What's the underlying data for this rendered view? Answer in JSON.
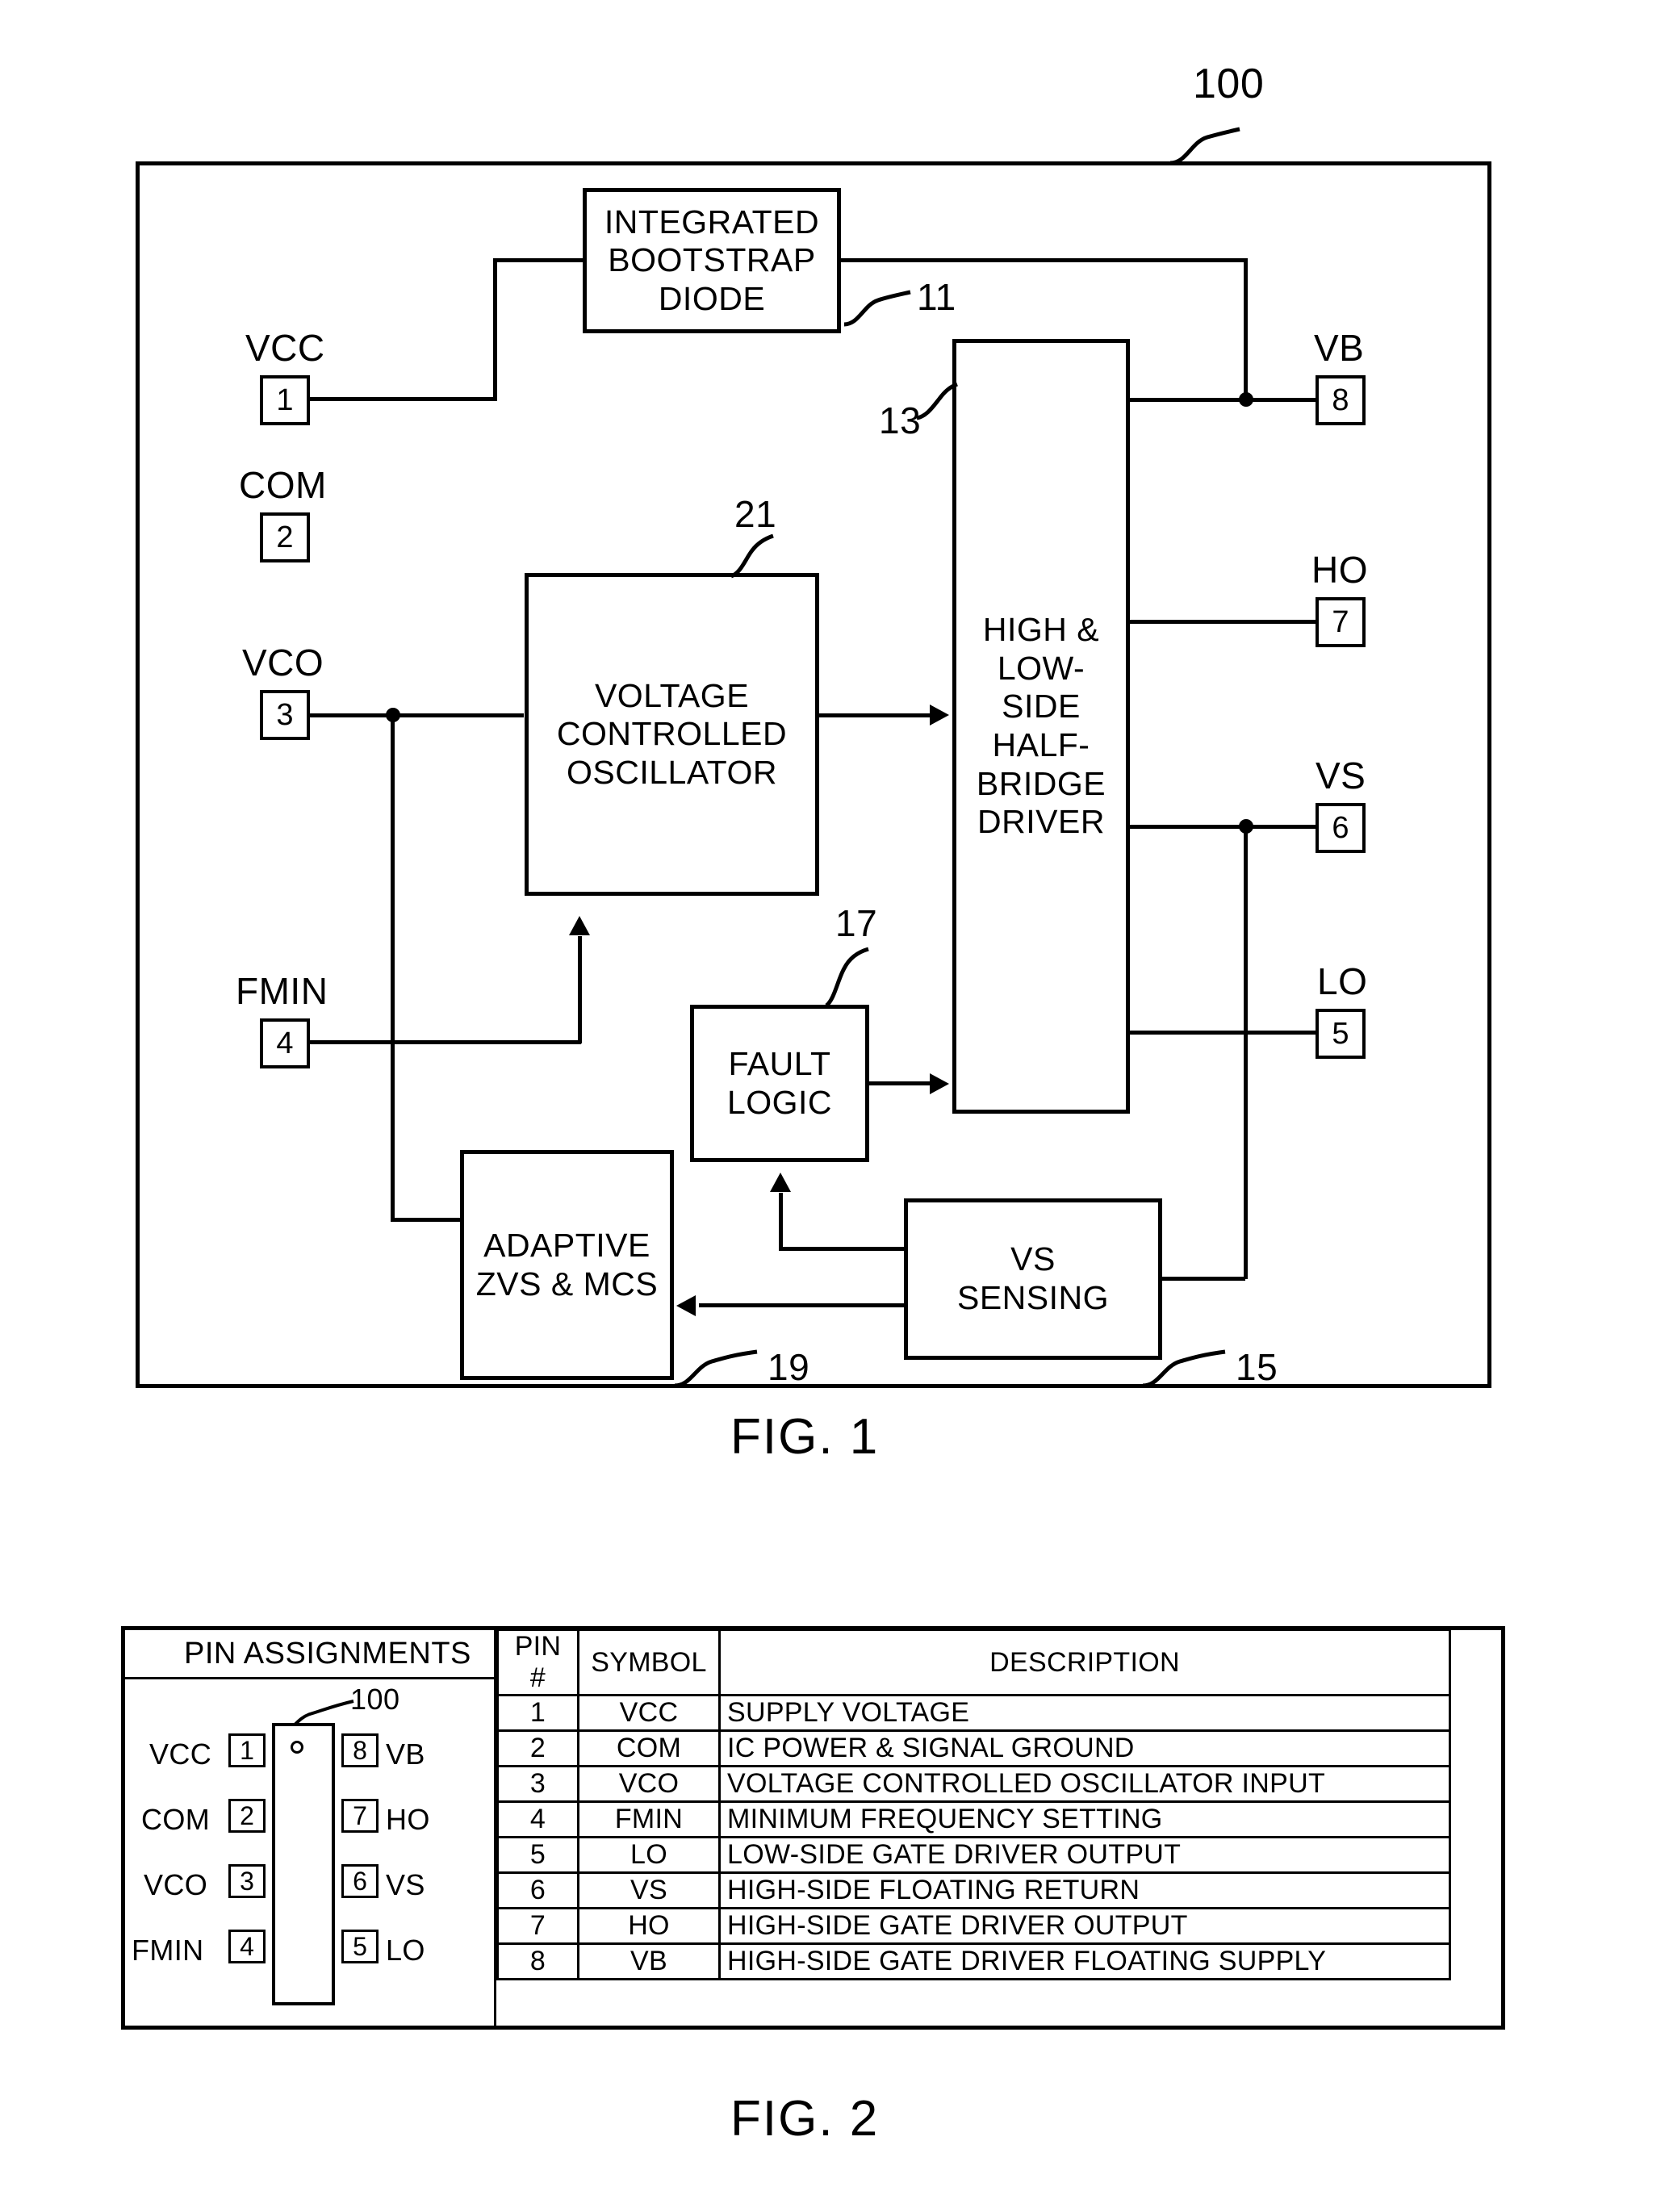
{
  "figure1": {
    "caption": "FIG. 1",
    "device_ref": "100",
    "blocks": [
      {
        "id": "bootstrap",
        "label": "INTEGRATED\nBOOTSTRAP\nDIODE",
        "ref": "11"
      },
      {
        "id": "vco",
        "label": "VOLTAGE\nCONTROLLED\nOSCILLATOR",
        "ref": "21"
      },
      {
        "id": "driver",
        "label": "HIGH &\nLOW-\nSIDE\nHALF-\nBRIDGE\nDRIVER",
        "ref": "13"
      },
      {
        "id": "fault",
        "label": "FAULT\nLOGIC",
        "ref": "17"
      },
      {
        "id": "zvs",
        "label": "ADAPTIVE\nZVS & MCS",
        "ref": "19"
      },
      {
        "id": "vs_sensing",
        "label": "VS\nSENSING",
        "ref": "15"
      }
    ],
    "pins_left": [
      {
        "name": "VCC",
        "num": "1"
      },
      {
        "name": "COM",
        "num": "2"
      },
      {
        "name": "VCO",
        "num": "3"
      },
      {
        "name": "FMIN",
        "num": "4"
      }
    ],
    "pins_right": [
      {
        "name": "VB",
        "num": "8"
      },
      {
        "name": "HO",
        "num": "7"
      },
      {
        "name": "VS",
        "num": "6"
      },
      {
        "name": "LO",
        "num": "5"
      }
    ]
  },
  "figure2": {
    "caption": "FIG. 2",
    "pin_assignments_title": "PIN ASSIGNMENTS",
    "package_ref": "100",
    "package_left_pins": [
      {
        "name": "VCC",
        "num": "1"
      },
      {
        "name": "COM",
        "num": "2"
      },
      {
        "name": "VCO",
        "num": "3"
      },
      {
        "name": "FMIN",
        "num": "4"
      }
    ],
    "package_right_pins": [
      {
        "num": "8",
        "name": "VB"
      },
      {
        "num": "7",
        "name": "HO"
      },
      {
        "num": "6",
        "name": "VS"
      },
      {
        "num": "5",
        "name": "LO"
      }
    ],
    "table": {
      "headers": [
        "PIN #",
        "SYMBOL",
        "DESCRIPTION"
      ],
      "rows": [
        {
          "pin": "1",
          "symbol": "VCC",
          "desc": "SUPPLY VOLTAGE"
        },
        {
          "pin": "2",
          "symbol": "COM",
          "desc": "IC POWER & SIGNAL GROUND"
        },
        {
          "pin": "3",
          "symbol": "VCO",
          "desc": "VOLTAGE CONTROLLED OSCILLATOR INPUT"
        },
        {
          "pin": "4",
          "symbol": "FMIN",
          "desc": "MINIMUM FREQUENCY SETTING"
        },
        {
          "pin": "5",
          "symbol": "LO",
          "desc": "LOW-SIDE GATE DRIVER OUTPUT"
        },
        {
          "pin": "6",
          "symbol": "VS",
          "desc": "HIGH-SIDE FLOATING RETURN"
        },
        {
          "pin": "7",
          "symbol": "HO",
          "desc": "HIGH-SIDE GATE DRIVER OUTPUT"
        },
        {
          "pin": "8",
          "symbol": "VB",
          "desc": "HIGH-SIDE GATE DRIVER FLOATING SUPPLY"
        }
      ]
    }
  }
}
